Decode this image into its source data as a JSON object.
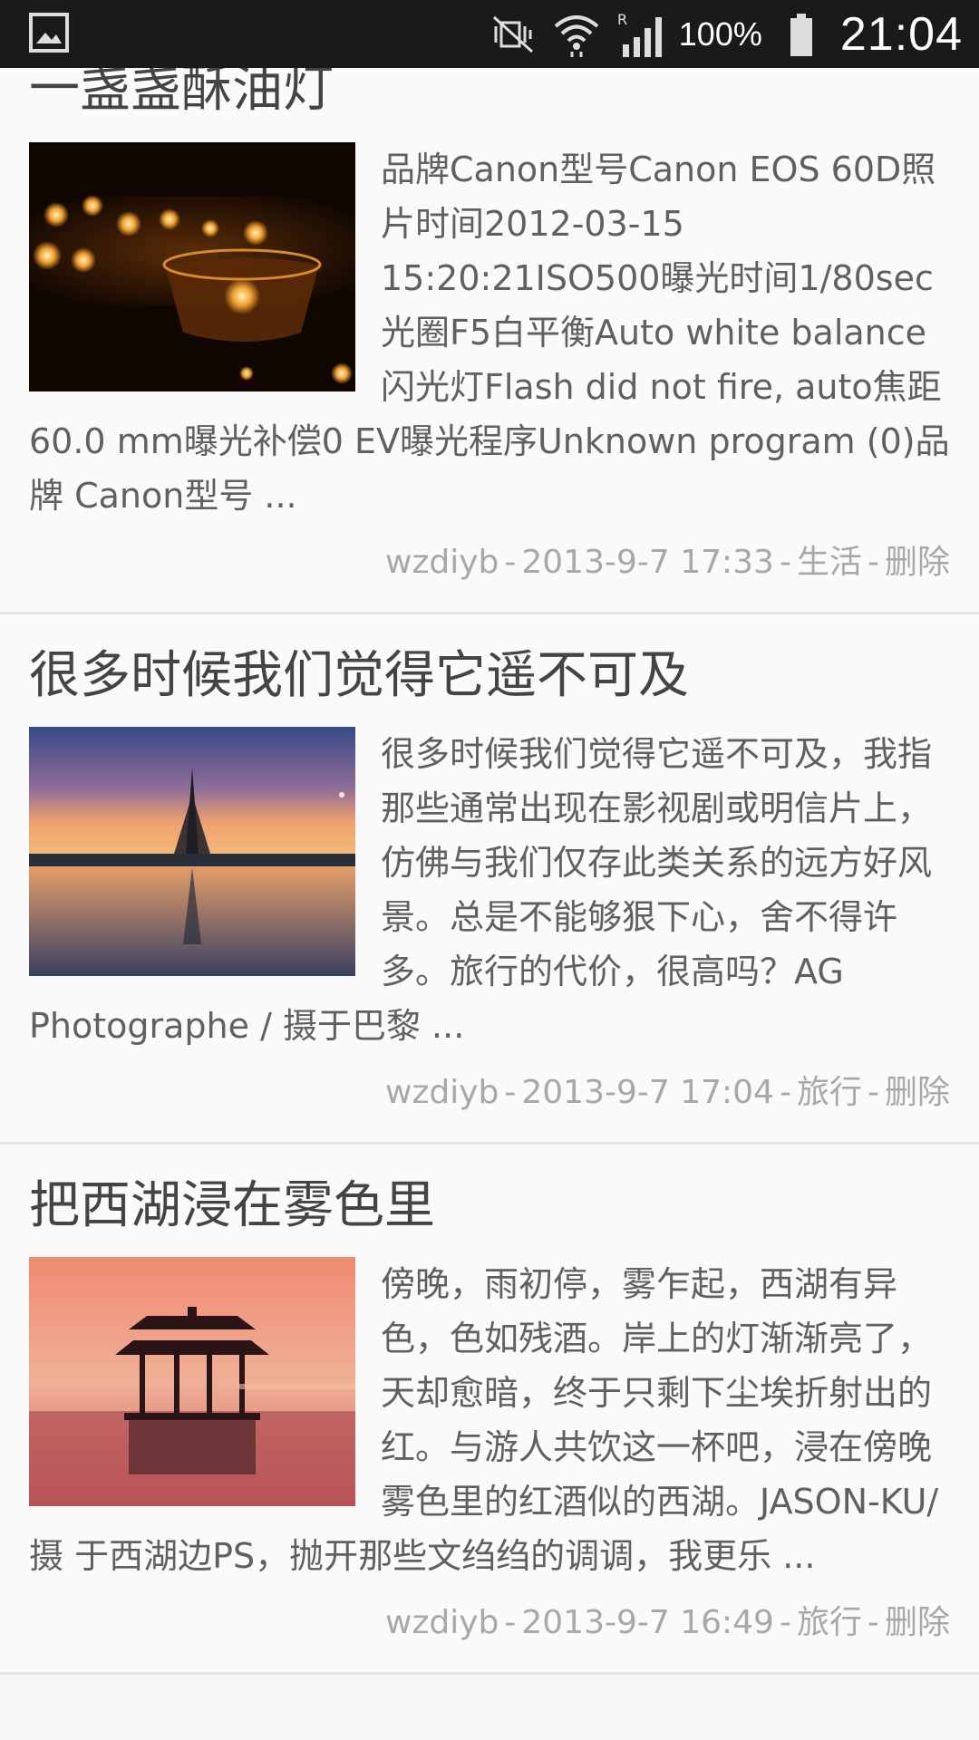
{
  "status_bar": {
    "battery": "100%",
    "time": "21:04"
  },
  "posts": [
    {
      "title": "一盏盏酥油灯",
      "excerpt": "品牌Canon型号Canon EOS 60D照片时间2012-03-15 15:20:21ISO500曝光时间1/80sec光圈F5白平衡Auto white balance闪光灯Flash did not fire, auto焦距60.0 mm曝光补偿0 EV曝光程序Unknown program (0)品牌 Canon型号 ...",
      "author": "wzdiyb",
      "date": "2013-9-7 17:33",
      "category": "生活",
      "delete": "删除"
    },
    {
      "title": "很多时候我们觉得它遥不可及",
      "excerpt": "很多时候我们觉得它遥不可及，我指那些通常出现在影视剧或明信片上，仿佛与我们仅存此类关系的远方好风景。总是不能够狠下心，舍不得许多。旅行的代价，很高吗？AG Photographe / 摄于巴黎 ...",
      "author": "wzdiyb",
      "date": "2013-9-7 17:04",
      "category": "旅行",
      "delete": "删除"
    },
    {
      "title": "把西湖浸在雾色里",
      "excerpt": "傍晚，雨初停，雾乍起，西湖有异色，色如残酒。岸上的灯渐渐亮了，天却愈暗，终于只剩下尘埃折射出的红。与游人共饮这一杯吧，浸在傍晚雾色里的红酒似的西湖。JASON-KU/摄 于西湖边PS，抛开那些文绉绉的调调，我更乐 ...",
      "author": "wzdiyb",
      "date": "2013-9-7 16:49",
      "category": "旅行",
      "delete": "删除"
    }
  ],
  "separator": "-"
}
